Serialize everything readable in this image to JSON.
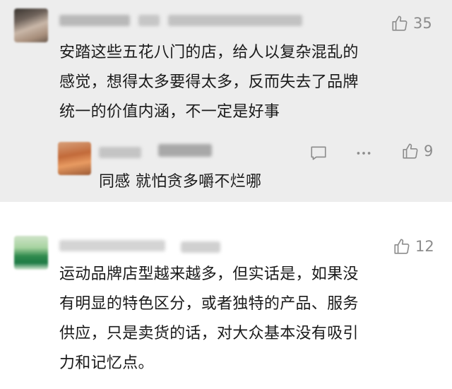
{
  "comments": [
    {
      "likes": "35",
      "text_lines": [
        "安踏这些五花八门的店，给人以复杂混乱的",
        "感觉，想得太多要得太多，反而失去了品牌",
        "统一的价值内涵，不一定是好事"
      ],
      "reply": {
        "likes": "9",
        "text": "同感 就怕贪多嚼不烂哪"
      }
    },
    {
      "likes": "12",
      "text_lines": [
        "运动品牌店型越来越多，但实话是，如果没",
        "有明显的特色区分，或者独特的产品、服务",
        "供应，只是卖货的话，对大众基本没有吸引",
        "力和记忆点。"
      ]
    }
  ],
  "icons": {
    "like": "thumbs-up-icon",
    "reply": "comment-bubble-icon",
    "more": "more-dots-icon"
  },
  "colors": {
    "highlight_bg": "#ededed",
    "icon_gray": "#8c8c8c",
    "text": "#1a1a1a"
  }
}
